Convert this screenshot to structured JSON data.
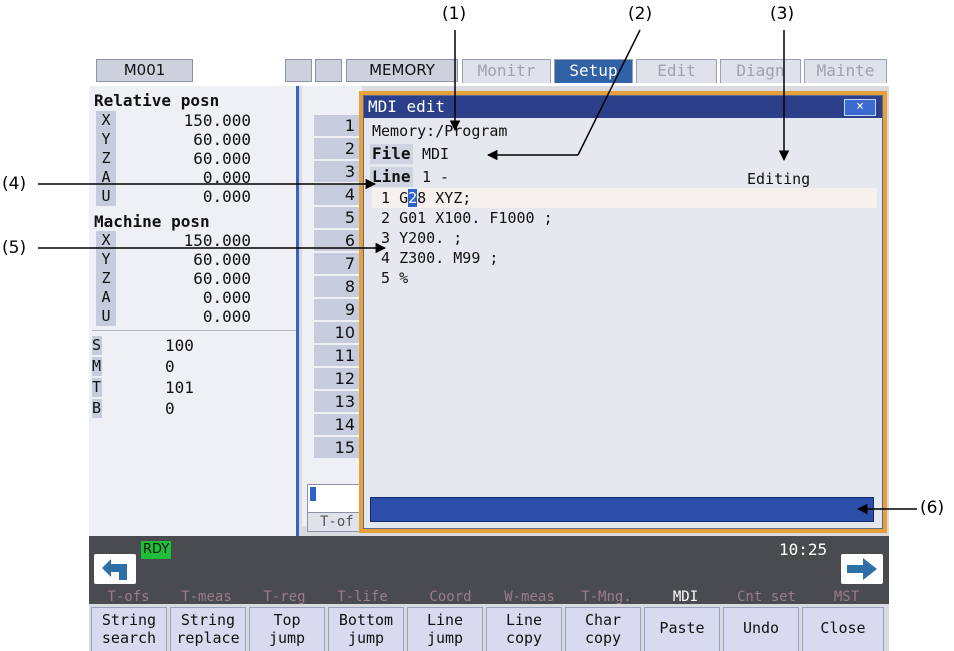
{
  "callouts": [
    "(1)",
    "(2)",
    "(3)",
    "(4)",
    "(5)",
    "(6)"
  ],
  "topbar": {
    "program": "M001",
    "mode": "MEMORY",
    "tabs": [
      "Monitr",
      "Setup",
      "Edit",
      "Diagn",
      "Mainte"
    ],
    "active_tab": "Setup"
  },
  "relative": {
    "title": "Relative posn",
    "axes": [
      {
        "name": "X",
        "value": "150.000"
      },
      {
        "name": "Y",
        "value": "60.000"
      },
      {
        "name": "Z",
        "value": "60.000"
      },
      {
        "name": "A",
        "value": "0.000"
      },
      {
        "name": "U",
        "value": "0.000"
      }
    ]
  },
  "machine": {
    "title": "Machine posn",
    "axes": [
      {
        "name": "X",
        "value": "150.000"
      },
      {
        "name": "Y",
        "value": "60.000"
      },
      {
        "name": "Z",
        "value": "60.000"
      },
      {
        "name": "A",
        "value": "0.000"
      },
      {
        "name": "U",
        "value": "0.000"
      }
    ]
  },
  "modal": [
    {
      "name": "S",
      "value": "100"
    },
    {
      "name": "M",
      "value": "0"
    },
    {
      "name": "T",
      "value": "101"
    },
    {
      "name": "B",
      "value": "0"
    }
  ],
  "row_numbers": [
    "1",
    "2",
    "3",
    "4",
    "5",
    "6",
    "7",
    "8",
    "9",
    "10",
    "11",
    "12",
    "13",
    "14",
    "15"
  ],
  "mini_tab": "T-of",
  "dialog": {
    "title": "MDI edit",
    "close": "×",
    "memory": "Memory:/Program",
    "file_label": "File",
    "file_value": "MDI",
    "line_label": "Line",
    "line_value": "1 -",
    "status": "Editing",
    "lines": [
      {
        "pre": " 1 G",
        "cursor": "2",
        "post": "8 XYZ;"
      },
      {
        "pre": " 2 G01 X100. F1000 ;",
        "cursor": "",
        "post": ""
      },
      {
        "pre": " 3 Y200. ;",
        "cursor": "",
        "post": ""
      },
      {
        "pre": " 4 Z300. M99 ;",
        "cursor": "",
        "post": ""
      },
      {
        "pre": " 5 %",
        "cursor": "",
        "post": ""
      }
    ]
  },
  "status": {
    "ready": "RDY",
    "time": "10:25"
  },
  "menu_row": [
    {
      "label": "T-ofs",
      "active": false
    },
    {
      "label": "T-meas",
      "active": false
    },
    {
      "label": "T-reg",
      "active": false
    },
    {
      "label": "T-life",
      "active": false
    },
    {
      "label": "Coord",
      "active": false
    },
    {
      "label": "W-meas",
      "active": false
    },
    {
      "label": "T-Mng.",
      "active": false
    },
    {
      "label": "MDI",
      "active": true
    },
    {
      "label": "Cnt set",
      "active": false
    },
    {
      "label": "MST",
      "active": false
    }
  ],
  "function_keys": [
    [
      "String",
      "search"
    ],
    [
      "String",
      "replace"
    ],
    [
      "Top",
      "jump"
    ],
    [
      "Bottom",
      "jump"
    ],
    [
      "Line",
      "jump"
    ],
    [
      "Line",
      "copy"
    ],
    [
      "Char",
      "copy"
    ],
    [
      "Paste"
    ],
    [
      "Undo"
    ],
    [
      "Close"
    ]
  ],
  "colors": {
    "dialog_border": "#e8a03a",
    "title_bar": "#2c3f8a",
    "active_tab": "#2f62a6",
    "ready": "#1fbd3c",
    "status_band": "#4a4b4e"
  }
}
